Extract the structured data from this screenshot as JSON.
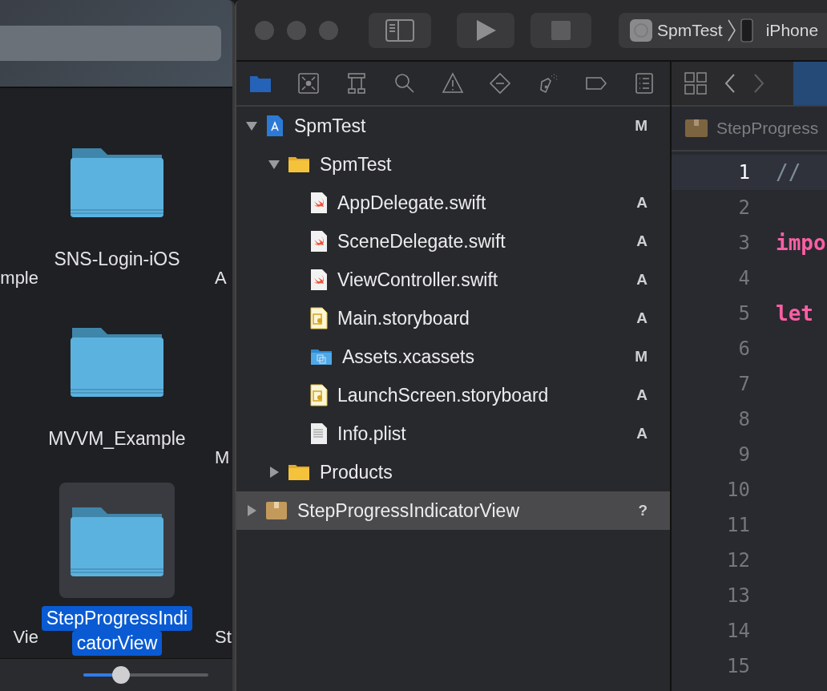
{
  "finder": {
    "rows": [
      {
        "left": "mple",
        "folder": {
          "label_lines": [
            "SNS-Login-iOS"
          ],
          "selected": false
        },
        "right": "A"
      },
      {
        "folder": {
          "label_lines": [
            "MVVM_Example"
          ],
          "selected": false
        },
        "right": "M"
      },
      {
        "left": "Vie",
        "folder": {
          "label_lines": [
            "StepProgressIndi",
            "catorView"
          ],
          "selected": true
        },
        "right": "St"
      }
    ],
    "icon_size": {
      "level": 0.3
    }
  },
  "xcode": {
    "scheme": {
      "target": "SpmTest",
      "device": "iPhone"
    },
    "navigator_tabs": [
      {
        "kind": "project",
        "selected": true
      },
      {
        "kind": "source-control",
        "selected": false
      },
      {
        "kind": "hierarchy",
        "selected": false
      },
      {
        "kind": "search",
        "selected": false
      },
      {
        "kind": "issues",
        "selected": false
      },
      {
        "kind": "tests",
        "selected": false
      },
      {
        "kind": "debug",
        "selected": false
      },
      {
        "kind": "breakpoints",
        "selected": false
      },
      {
        "kind": "report",
        "selected": false
      }
    ],
    "tree": [
      {
        "name": "SpmTest",
        "kind": "project",
        "status": "M",
        "expanded": true,
        "selected": false,
        "children": [
          {
            "name": "SpmTest",
            "kind": "folder",
            "expanded": true,
            "selected": false,
            "children": [
              {
                "name": "AppDelegate.swift",
                "kind": "swift",
                "status": "A",
                "selected": false
              },
              {
                "name": "SceneDelegate.swift",
                "kind": "swift",
                "status": "A",
                "selected": false
              },
              {
                "name": "ViewController.swift",
                "kind": "swift",
                "status": "A",
                "selected": false
              },
              {
                "name": "Main.storyboard",
                "kind": "storyboard",
                "status": "A",
                "selected": false
              },
              {
                "name": "Assets.xcassets",
                "kind": "assets",
                "status": "M",
                "selected": false
              },
              {
                "name": "LaunchScreen.storyboard",
                "kind": "storyboard",
                "status": "A",
                "selected": false
              },
              {
                "name": "Info.plist",
                "kind": "plist",
                "status": "A",
                "selected": false
              }
            ]
          },
          {
            "name": "Products",
            "kind": "folder",
            "expanded": false,
            "selected": false
          }
        ]
      },
      {
        "name": "StepProgressIndicatorView",
        "kind": "package",
        "status": "?",
        "expanded": false,
        "selected": true
      }
    ],
    "editor": {
      "breadcrumb": "StepProgress",
      "lines": [
        {
          "number": "1",
          "code": "//",
          "kind": "comment",
          "current": true
        },
        {
          "number": "2",
          "current": false
        },
        {
          "number": "3",
          "code": "impo",
          "kind": "keyword",
          "current": false
        },
        {
          "number": "4",
          "current": false
        },
        {
          "number": "5",
          "code": "let",
          "kind": "keyword",
          "current": false
        },
        {
          "number": "6",
          "current": false
        },
        {
          "number": "7",
          "current": false
        },
        {
          "number": "8",
          "current": false
        },
        {
          "number": "9",
          "current": false
        },
        {
          "number": "10",
          "current": false
        },
        {
          "number": "11",
          "current": false
        },
        {
          "number": "12",
          "current": false
        },
        {
          "number": "13",
          "current": false
        },
        {
          "number": "14",
          "current": false
        },
        {
          "number": "15",
          "current": false
        }
      ]
    }
  }
}
